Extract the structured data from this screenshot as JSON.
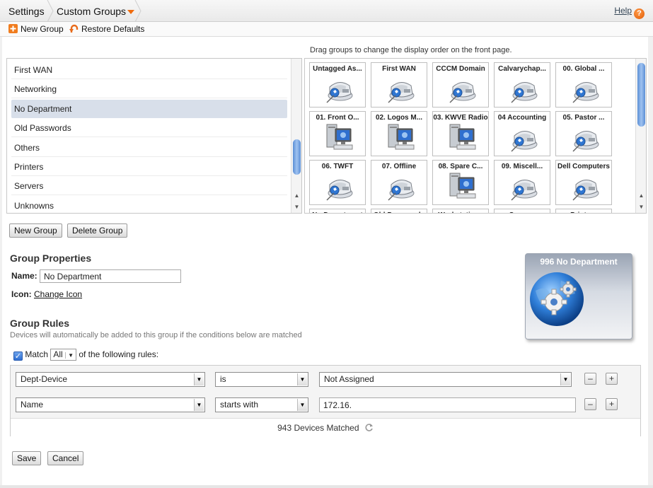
{
  "header": {
    "breadcrumb": [
      "Settings",
      "Custom Groups"
    ],
    "help_label": "Help",
    "help_glyph": "?"
  },
  "toolbar": {
    "new_group_label": "New Group",
    "restore_defaults_label": "Restore Defaults"
  },
  "group_list": {
    "items": [
      "First WAN",
      "Networking",
      "No Department",
      "Old Passwords",
      "Others",
      "Printers",
      "Servers",
      "Unknowns"
    ],
    "selected": "No Department"
  },
  "tile_grid": {
    "hint": "Drag groups to change the display order on the front page.",
    "tiles": [
      {
        "label": "Untagged As...",
        "icon": "phone-icon"
      },
      {
        "label": "First WAN",
        "icon": "phone-icon"
      },
      {
        "label": "CCCM Domain",
        "icon": "phone-icon"
      },
      {
        "label": "Calvarychap...",
        "icon": "phone-icon"
      },
      {
        "label": "00. Global ...",
        "icon": "phone-icon"
      },
      {
        "label": "01. Front O...",
        "icon": "desktop-icon"
      },
      {
        "label": "02. Logos M...",
        "icon": "desktop-icon"
      },
      {
        "label": "03. KWVE Radio",
        "icon": "desktop-icon"
      },
      {
        "label": "04 Accounting",
        "icon": "phone-icon"
      },
      {
        "label": "05. Pastor ...",
        "icon": "phone-icon"
      },
      {
        "label": "06. TWFT",
        "icon": "phone-icon"
      },
      {
        "label": "07. Offline",
        "icon": "phone-icon"
      },
      {
        "label": "08. Spare C...",
        "icon": "desktop-icon"
      },
      {
        "label": "09. Miscell...",
        "icon": "phone-icon"
      },
      {
        "label": "Dell Computers",
        "icon": "phone-icon"
      },
      {
        "label": "No Department",
        "icon": "phone-icon"
      },
      {
        "label": "Old Passwords",
        "icon": "phone-icon"
      },
      {
        "label": "Workstations",
        "icon": "phone-icon"
      },
      {
        "label": "Servers",
        "icon": "phone-icon"
      },
      {
        "label": "Printers",
        "icon": "phone-icon"
      }
    ]
  },
  "list_buttons": {
    "new_group": "New Group",
    "delete_group": "Delete Group"
  },
  "properties": {
    "title": "Group Properties",
    "name_label": "Name:",
    "name_value": "No Department",
    "icon_label": "Icon:",
    "change_icon": "Change Icon",
    "preview_title": "996 No Department"
  },
  "rules": {
    "title": "Group Rules",
    "description": "Devices will automatically be added to this group if the conditions below are matched",
    "match_label": "Match",
    "match_value": "All",
    "match_suffix": "of the following rules:",
    "rows": [
      {
        "field": "Dept-Device",
        "operator": "is",
        "value": "Not Assigned",
        "value_is_select": true
      },
      {
        "field": "Name",
        "operator": "starts with",
        "value": "172.16.",
        "value_is_select": false
      }
    ],
    "matched_text": "943 Devices Matched"
  },
  "footer": {
    "save": "Save",
    "cancel": "Cancel"
  },
  "colors": {
    "accent_orange": "#f06a0c",
    "selection": "#d8dfea",
    "scroll_blue": "#5b8fd6"
  }
}
